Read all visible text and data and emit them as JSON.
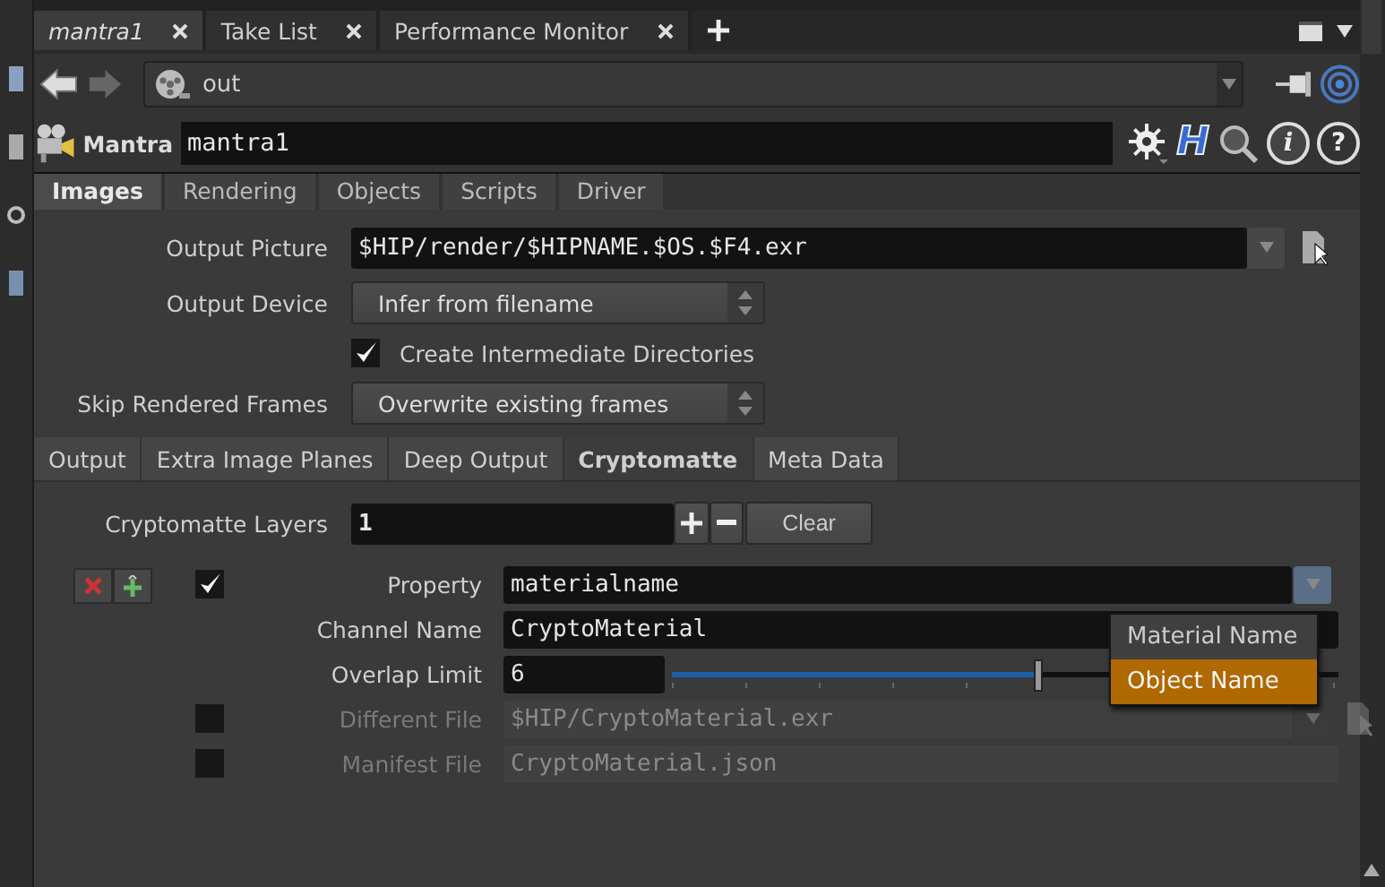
{
  "pane_tabs": [
    {
      "label": "mantra1",
      "selected": true
    },
    {
      "label": "Take List",
      "selected": false
    },
    {
      "label": "Performance Monitor",
      "selected": false
    }
  ],
  "path": {
    "value": "out"
  },
  "node": {
    "type": "Mantra",
    "name": "mantra1",
    "tool_buttons": [
      "H",
      "i",
      "?"
    ]
  },
  "main_tabs": [
    {
      "label": "Images",
      "selected": true
    },
    {
      "label": "Rendering",
      "selected": false
    },
    {
      "label": "Objects",
      "selected": false
    },
    {
      "label": "Scripts",
      "selected": false
    },
    {
      "label": "Driver",
      "selected": false
    }
  ],
  "parameters": [
    {
      "kind": "file",
      "label": "Output Picture",
      "value": "$HIP/render/$HIPNAME.$OS.$F4.exr"
    },
    {
      "kind": "menu",
      "label": "Output Device",
      "value": "Infer from filename"
    },
    {
      "kind": "toggle",
      "label": "Create Intermediate Directories",
      "checked": true
    },
    {
      "kind": "menu",
      "label": "Skip Rendered Frames",
      "value": "Overwrite existing frames"
    }
  ],
  "sub_tabs": [
    {
      "label": "Output",
      "selected": false
    },
    {
      "label": "Extra Image Planes",
      "selected": false
    },
    {
      "label": "Deep Output",
      "selected": false
    },
    {
      "label": "Cryptomatte",
      "selected": true
    },
    {
      "label": "Meta Data",
      "selected": false
    }
  ],
  "layers": {
    "label": "Cryptomatte Layers",
    "value": "1",
    "clear": "Clear"
  },
  "layer_parameters": [
    {
      "kind": "string_menu",
      "label": "Property",
      "value": "materialname",
      "checked": true,
      "disabled": false
    },
    {
      "kind": "string",
      "label": "Channel Name",
      "value": "CryptoMaterial",
      "disabled": false
    },
    {
      "kind": "slider",
      "label": "Overlap Limit",
      "value": "6",
      "level": 0.55,
      "disabled": false
    },
    {
      "kind": "file",
      "label": "Different File",
      "value": "$HIP/CryptoMaterial.exr",
      "checked": false,
      "disabled": true
    },
    {
      "kind": "string",
      "label": "Manifest File",
      "value": "CryptoMaterial.json",
      "checked": false,
      "disabled": true
    }
  ],
  "popup_menu": [
    {
      "label": "Material Name",
      "selected": false
    },
    {
      "label": "Object Name",
      "selected": true
    }
  ]
}
